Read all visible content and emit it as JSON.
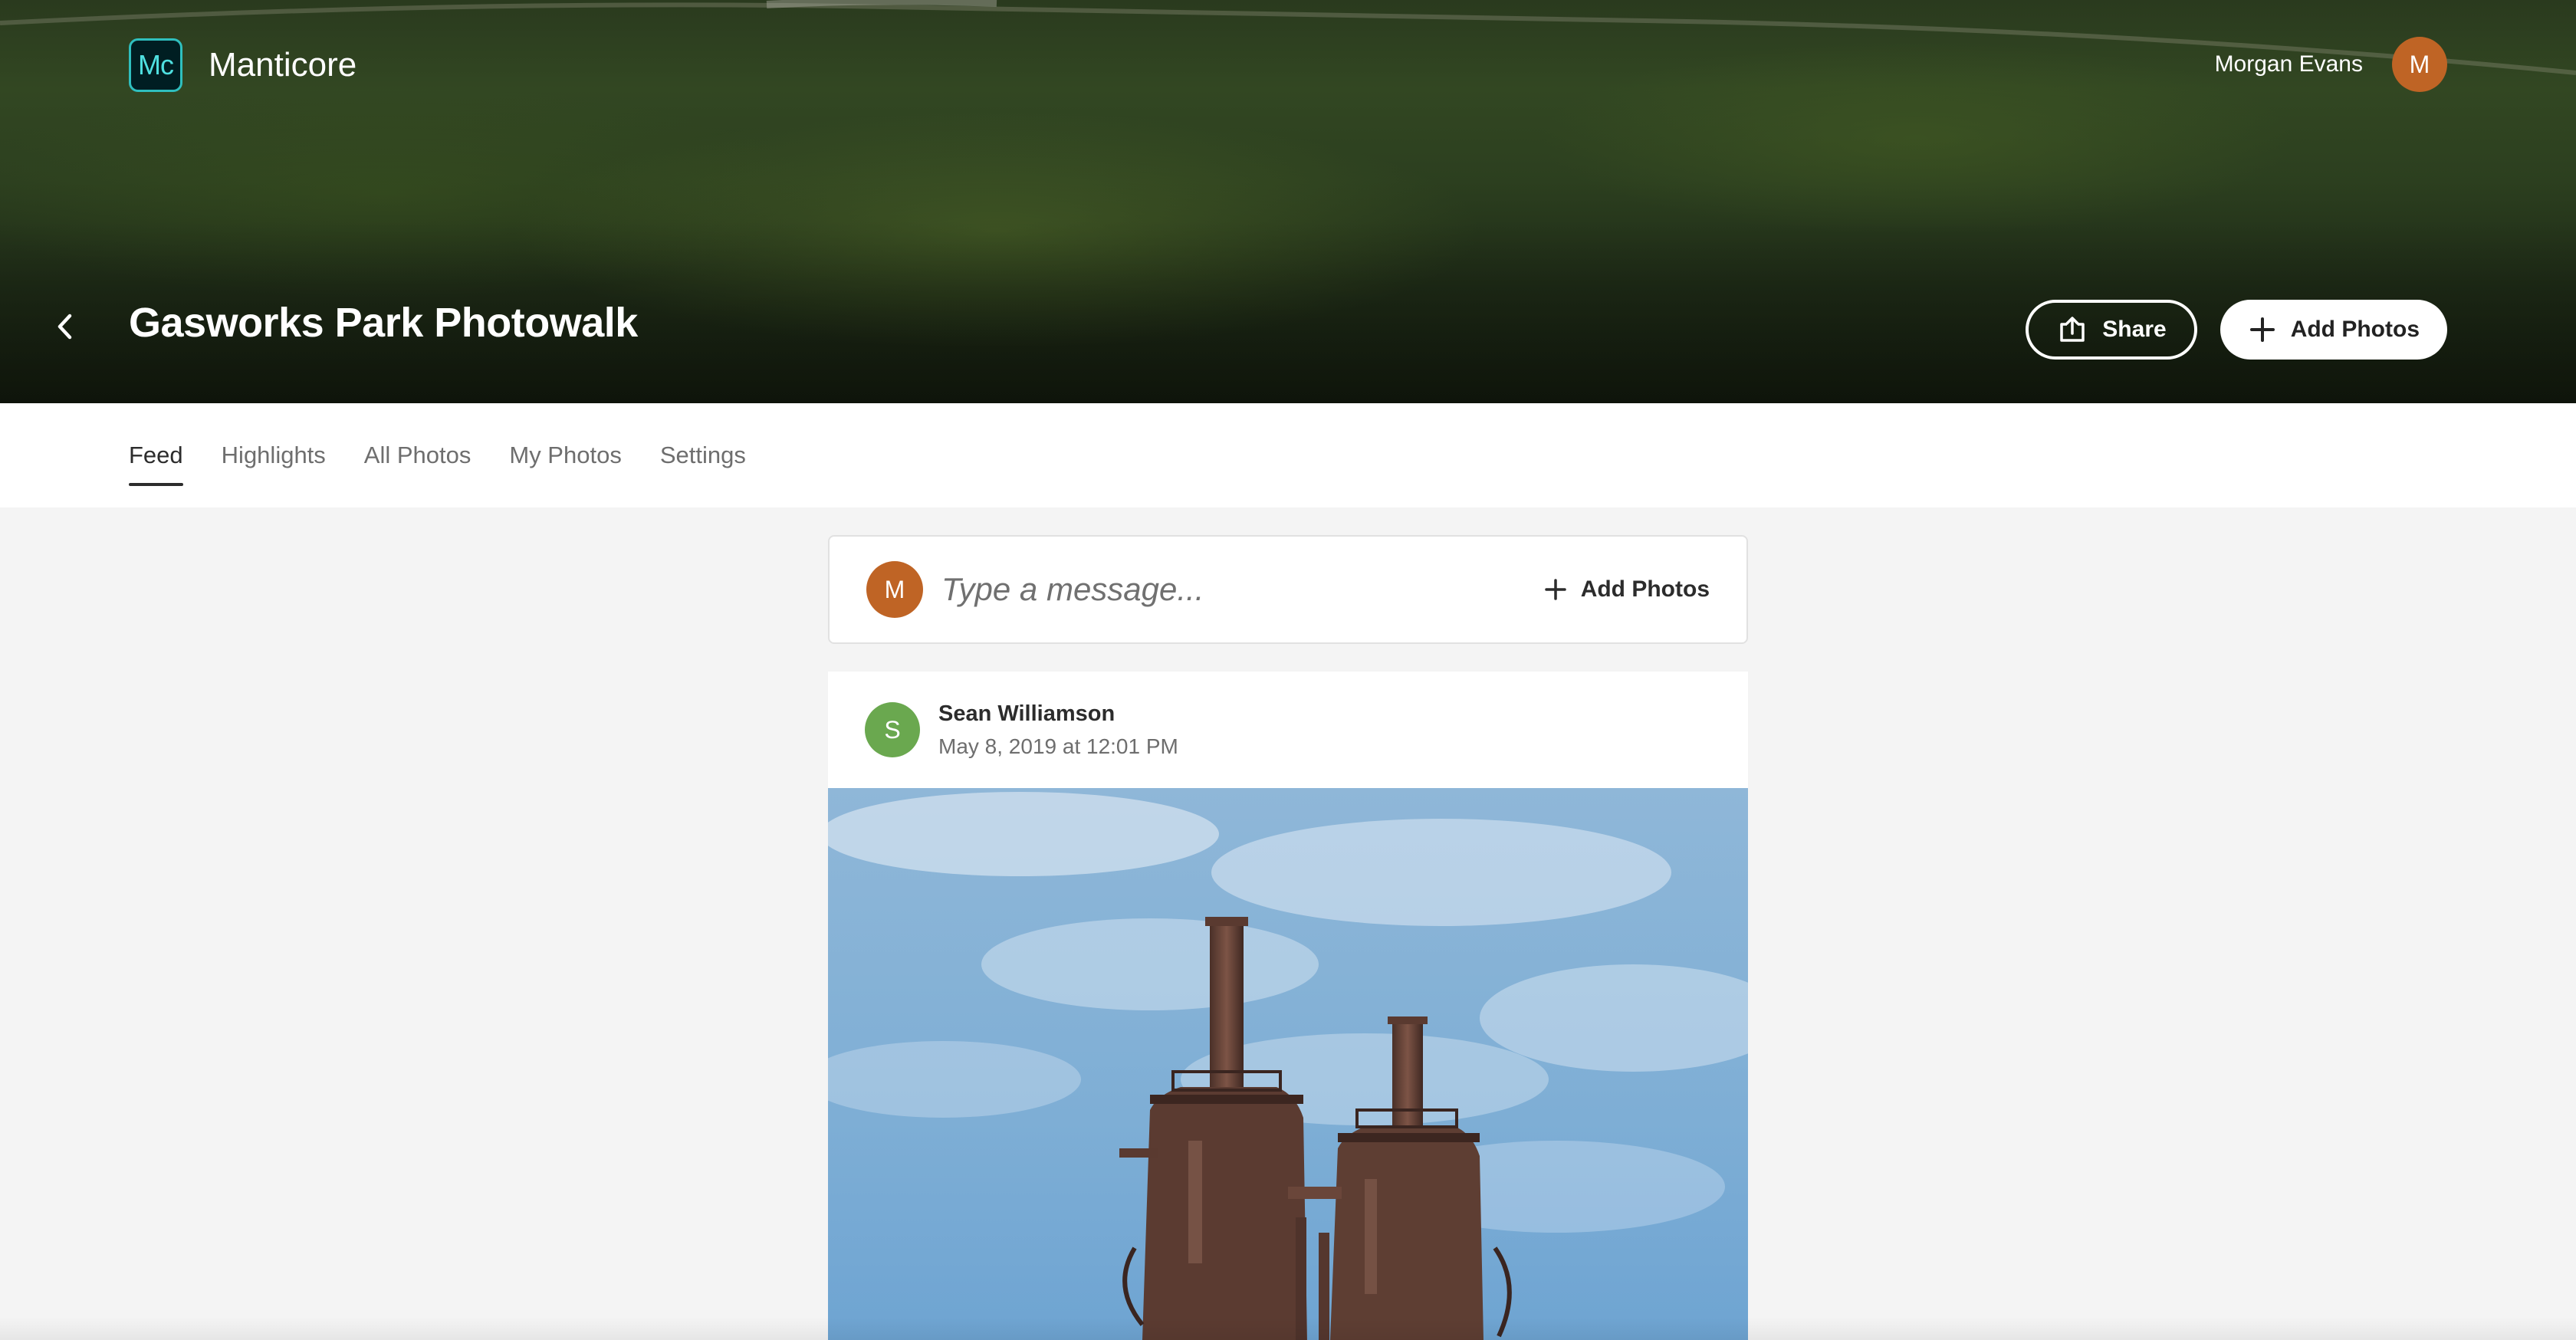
{
  "app": {
    "logo_text": "Mc",
    "name": "Manticore"
  },
  "user": {
    "name": "Morgan Evans",
    "initial": "M",
    "avatar_color": "#bf6425"
  },
  "album": {
    "title": "Gasworks Park Photowalk",
    "share_label": "Share",
    "add_photos_label": "Add Photos"
  },
  "tabs": [
    {
      "label": "Feed",
      "active": true
    },
    {
      "label": "Highlights",
      "active": false
    },
    {
      "label": "All Photos",
      "active": false
    },
    {
      "label": "My Photos",
      "active": false
    },
    {
      "label": "Settings",
      "active": false
    }
  ],
  "composer": {
    "avatar_initial": "M",
    "placeholder": "Type a message...",
    "add_photos_label": "Add Photos"
  },
  "posts": [
    {
      "author": "Sean Williamson",
      "initial": "S",
      "avatar_color": "#6aa84f",
      "timestamp": "May 8, 2019 at 12:01 PM"
    }
  ],
  "icons": {
    "back": "chevron-left-icon",
    "share": "share-icon",
    "add": "plus-icon"
  },
  "colors": {
    "accent_brand": "#2fbfbf",
    "tab_active": "#2c2c2c",
    "tab_inactive": "#6e6e6e",
    "background": "#f4f4f4"
  }
}
